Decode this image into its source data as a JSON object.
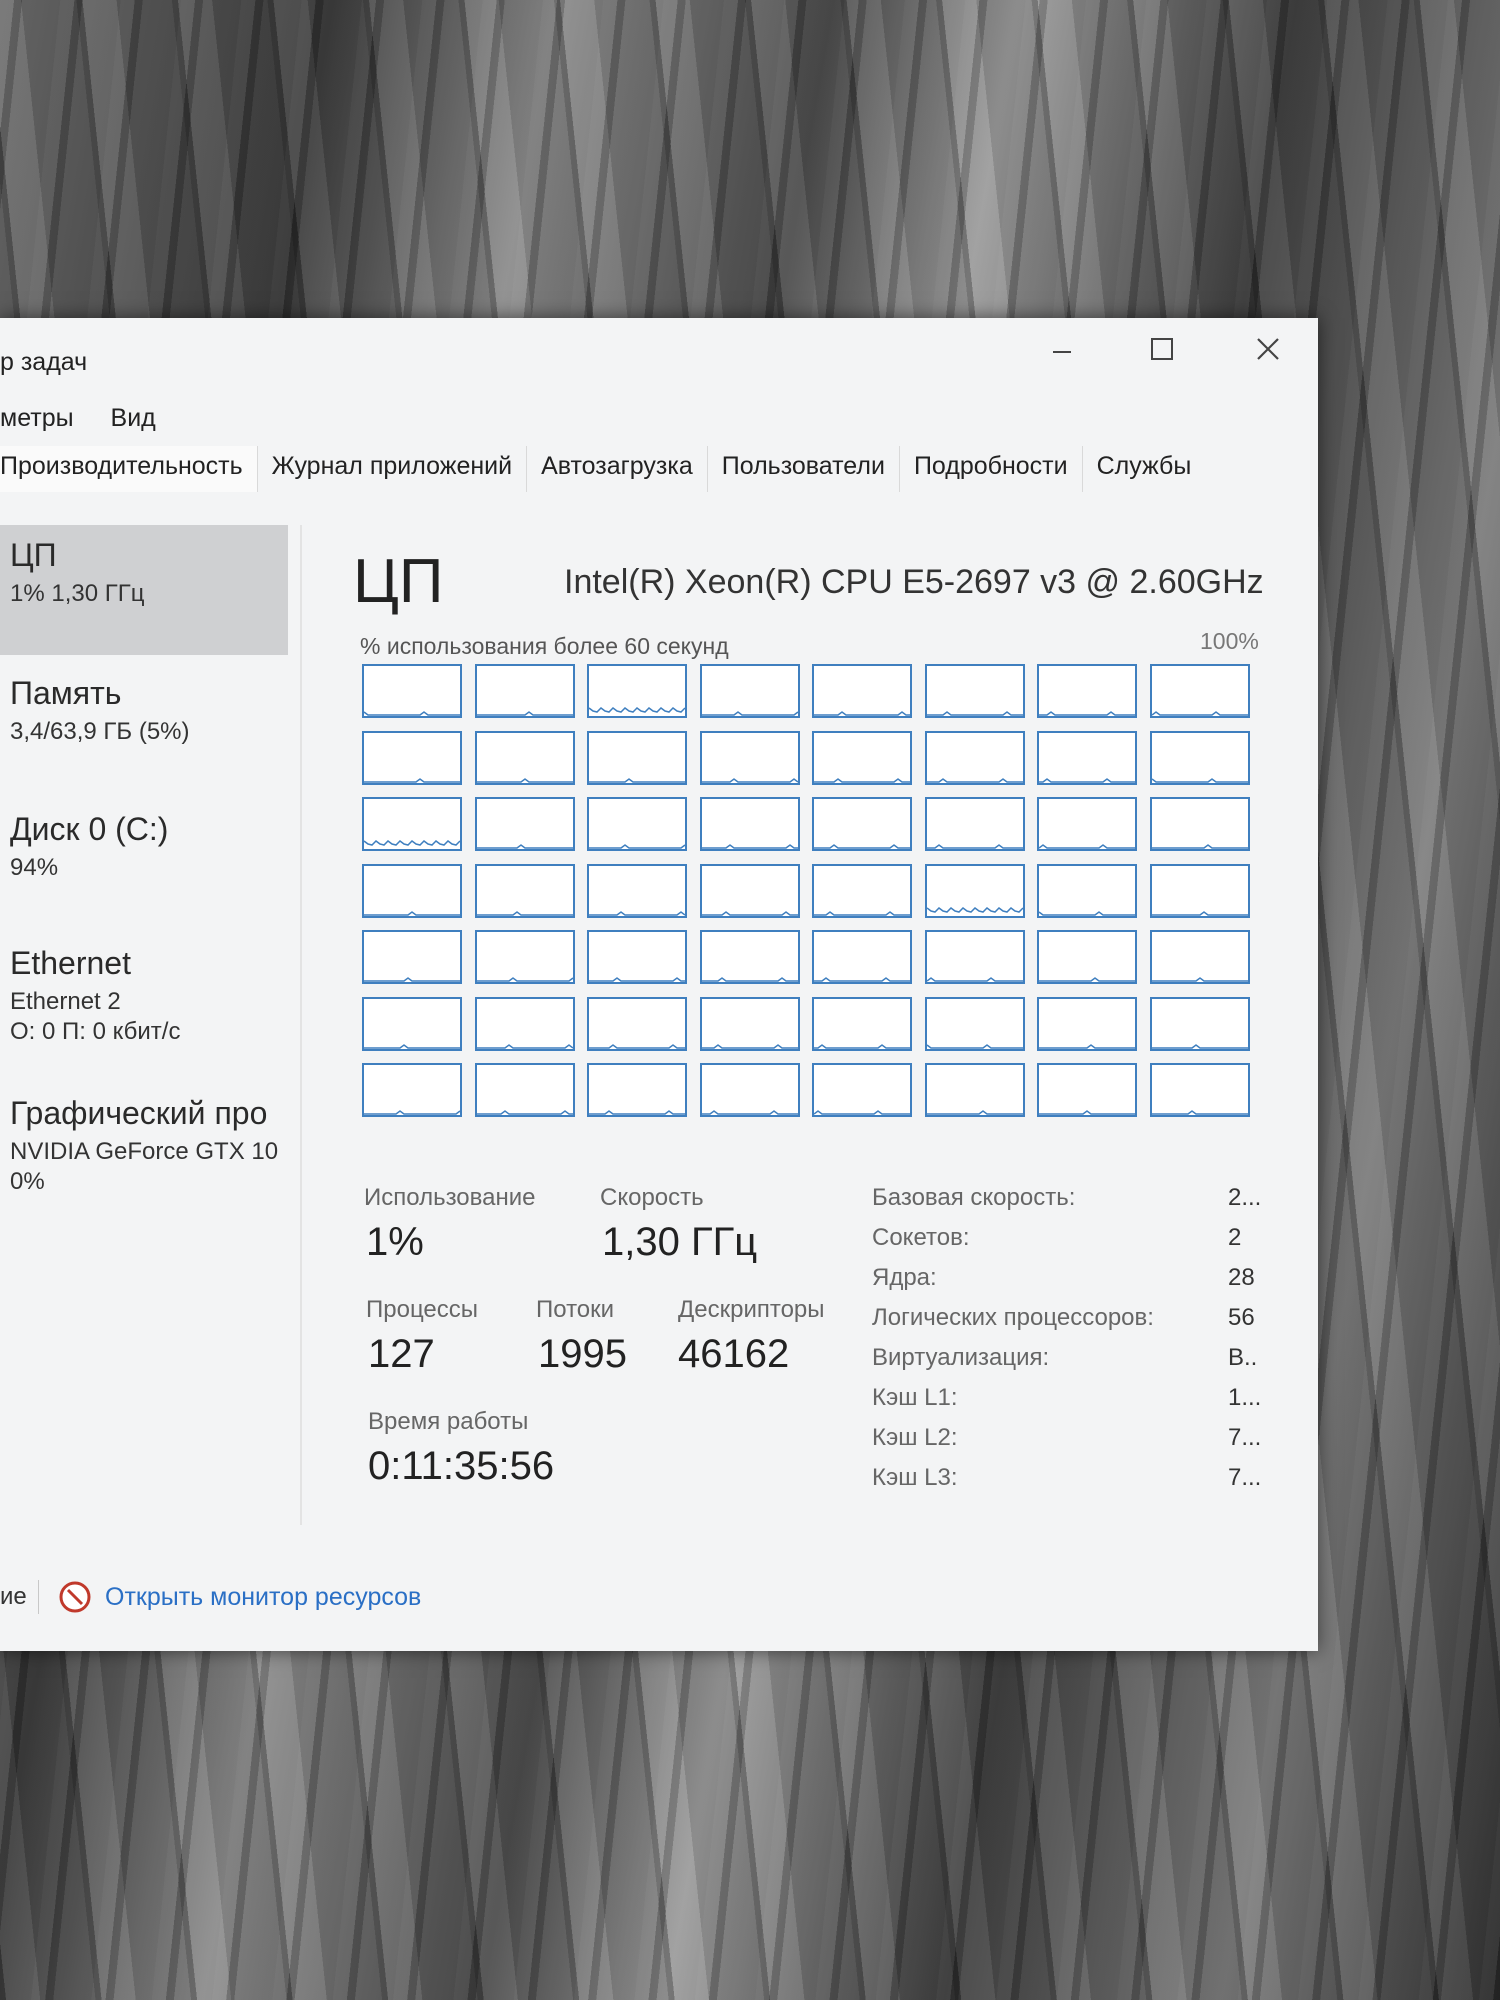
{
  "window": {
    "title": "р задач",
    "controls": {
      "minimize": "minimize-icon",
      "maximize": "maximize-icon",
      "close": "close-icon"
    }
  },
  "menu": {
    "items": [
      "метры",
      "Вид"
    ]
  },
  "tabs": [
    {
      "label": "Производительность",
      "active": true
    },
    {
      "label": "Журнал приложений",
      "active": false
    },
    {
      "label": "Автозагрузка",
      "active": false
    },
    {
      "label": "Пользователи",
      "active": false
    },
    {
      "label": "Подробности",
      "active": false
    },
    {
      "label": "Службы",
      "active": false
    }
  ],
  "sidebar": {
    "items": [
      {
        "title": "ЦП",
        "lines": [
          "1% 1,30 ГГц"
        ],
        "selected": true
      },
      {
        "title": "Память",
        "lines": [
          "3,4/63,9 ГБ (5%)"
        ],
        "selected": false
      },
      {
        "title": "Диск 0 (C:)",
        "lines": [
          "94%"
        ],
        "selected": false
      },
      {
        "title": "Ethernet",
        "lines": [
          "Ethernet 2",
          "О: 0 П: 0 кбит/с"
        ],
        "selected": false
      },
      {
        "title": "Графический про",
        "lines": [
          "NVIDIA GeForce GTX 10",
          "0%"
        ],
        "selected": false
      }
    ]
  },
  "cpu": {
    "heading": "ЦП",
    "model": "Intel(R) Xeon(R) CPU E5-2697 v3 @ 2.60GHz",
    "graph_caption": "% использования более 60 секунд",
    "graph_max": "100%",
    "logical_graphs": {
      "count": 56,
      "columns": 8,
      "line_color": "#3f7fbf",
      "busy_cores": [
        2,
        16,
        29
      ]
    }
  },
  "stats": {
    "usage_label": "Использование",
    "usage_value": "1%",
    "speed_label": "Скорость",
    "speed_value": "1,30 ГГц",
    "processes_label": "Процессы",
    "processes_value": "127",
    "threads_label": "Потоки",
    "threads_value": "1995",
    "handles_label": "Дескрипторы",
    "handles_value": "46162",
    "uptime_label": "Время работы",
    "uptime_value": "0:11:35:56"
  },
  "properties": [
    {
      "label": "Базовая скорость:",
      "value": "2..."
    },
    {
      "label": "Сокетов:",
      "value": "2"
    },
    {
      "label": "Ядра:",
      "value": "28"
    },
    {
      "label": "Логических процессоров:",
      "value": "56"
    },
    {
      "label": "Виртуализация:",
      "value": "В.."
    },
    {
      "label": "Кэш L1:",
      "value": "1..."
    },
    {
      "label": "Кэш L2:",
      "value": "7..."
    },
    {
      "label": "Кэш L3:",
      "value": "7..."
    }
  ],
  "footer": {
    "left_text": "ие",
    "resource_monitor_link": "Открыть монитор ресурсов"
  }
}
